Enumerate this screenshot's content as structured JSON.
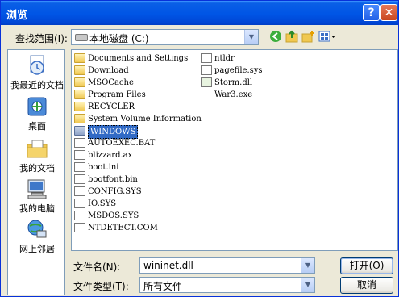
{
  "window": {
    "title": "浏览",
    "help": "?",
    "close": "✕"
  },
  "lookin": {
    "label": "查找范围(I):",
    "value": "本地磁盘 (C:)"
  },
  "places": [
    {
      "label": "我最近的文档"
    },
    {
      "label": "桌面"
    },
    {
      "label": "我的文档"
    },
    {
      "label": "我的电脑"
    },
    {
      "label": "网上邻居"
    }
  ],
  "files": [
    {
      "name": "Documents and Settings",
      "type": "folder"
    },
    {
      "name": "Download",
      "type": "folder"
    },
    {
      "name": "MSOCache",
      "type": "folder"
    },
    {
      "name": "Program Files",
      "type": "folder"
    },
    {
      "name": "RECYCLER",
      "type": "folder"
    },
    {
      "name": "System Volume Information",
      "type": "folder"
    },
    {
      "name": "WINDOWS",
      "type": "folder",
      "selected": true
    },
    {
      "name": "AUTOEXEC.BAT",
      "type": "file"
    },
    {
      "name": "blizzard.ax",
      "type": "file"
    },
    {
      "name": "boot.ini",
      "type": "file"
    },
    {
      "name": "bootfont.bin",
      "type": "file"
    },
    {
      "name": "CONFIG.SYS",
      "type": "file"
    },
    {
      "name": "IO.SYS",
      "type": "file"
    },
    {
      "name": "MSDOS.SYS",
      "type": "file"
    },
    {
      "name": "NTDETECT.COM",
      "type": "file"
    },
    {
      "name": "ntldr",
      "type": "file"
    },
    {
      "name": "pagefile.sys",
      "type": "file"
    },
    {
      "name": "Storm.dll",
      "type": "file"
    },
    {
      "name": "War3.exe",
      "type": "file"
    }
  ],
  "filename": {
    "label": "文件名(N):",
    "value": "wininet.dll"
  },
  "filetype": {
    "label": "文件类型(T):",
    "value": "所有文件"
  },
  "buttons": {
    "open": "打开(O)",
    "cancel": "取消"
  }
}
